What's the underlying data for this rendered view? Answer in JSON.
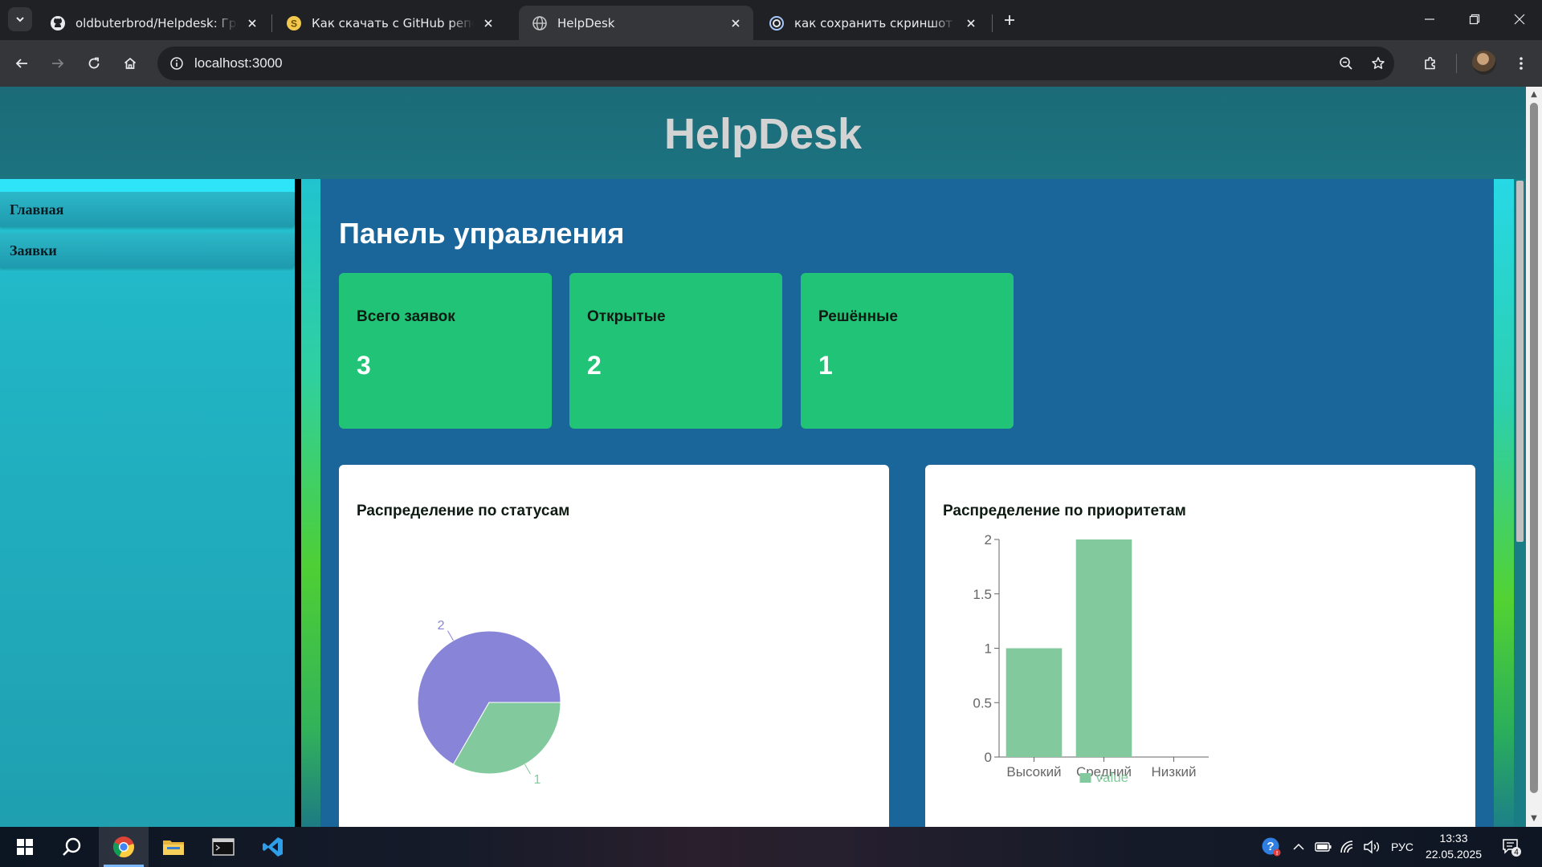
{
  "browser": {
    "tabs": [
      {
        "title": "oldbuterbrod/Helpdesk: Графи",
        "favicon": "github-icon",
        "active": false
      },
      {
        "title": "Как скачать с GitHub репозито",
        "favicon": "s-coin-icon",
        "active": false
      },
      {
        "title": "HelpDesk",
        "favicon": "globe-icon",
        "active": true
      },
      {
        "title": "как сохранить скриншот на пк",
        "favicon": "swirl-icon",
        "active": false
      }
    ],
    "url": "localhost:3000"
  },
  "page": {
    "header_title": "HelpDesk",
    "sidebar": {
      "items": [
        {
          "label": "Главная"
        },
        {
          "label": "Заявки"
        }
      ]
    },
    "dashboard_title": "Панель управления",
    "stats": [
      {
        "label": "Всего заявок",
        "value": "3"
      },
      {
        "label": "Открытые",
        "value": "2"
      },
      {
        "label": "Решённые",
        "value": "1"
      }
    ],
    "charts": {
      "status_title": "Распределение по статусам",
      "priority_title": "Распределение по приоритетам"
    },
    "colors": {
      "header_bg": "#1b6b78",
      "main_bg": "#1a6599",
      "card_green": "#21c477",
      "pie_purple": "#8884d8",
      "bar_green": "#82ca9d"
    }
  },
  "chart_data": [
    {
      "type": "pie",
      "title": "Распределение по статусам",
      "slices": [
        {
          "value": 2,
          "label": "2",
          "color": "#8884d8"
        },
        {
          "value": 1,
          "label": "1",
          "color": "#82ca9d"
        }
      ]
    },
    {
      "type": "bar",
      "title": "Распределение по приоритетам",
      "categories": [
        "Высокий",
        "Средний",
        "Низкий"
      ],
      "series": [
        {
          "name": "value",
          "values": [
            1,
            2,
            0
          ],
          "color": "#82ca9d"
        }
      ],
      "ylim": [
        0,
        2
      ],
      "yticks": [
        "0",
        "0.5",
        "1",
        "1.5",
        "2"
      ],
      "legend": "bottom"
    }
  ],
  "taskbar": {
    "language": "РУС",
    "time": "13:33",
    "date": "22.05.2025",
    "notification_count": "4"
  }
}
